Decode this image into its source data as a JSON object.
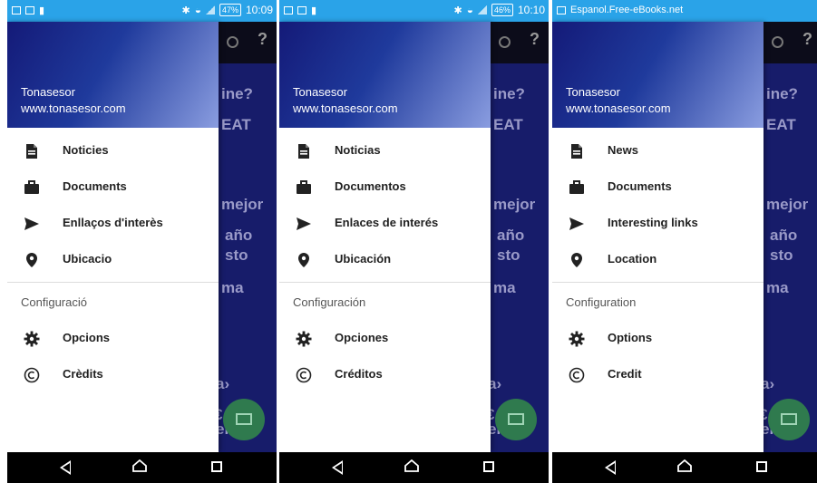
{
  "phones": [
    {
      "status": {
        "battery": "47%",
        "time": "10:09",
        "notification": ""
      },
      "drawer": {
        "name": "Tonasesor",
        "url": "www.tonasesor.com",
        "items": [
          "Noticies",
          "Documents",
          "Enllaços d'interès",
          "Ubicacio"
        ],
        "section_title": "Configuració",
        "config_items": [
          "Opcions",
          "Crèdits"
        ]
      },
      "background_texts": [
        "ine?",
        "EAT",
        "mejor",
        "año",
        "sto",
        "ma",
        "a›",
        "€",
        "en"
      ]
    },
    {
      "status": {
        "battery": "46%",
        "time": "10:10",
        "notification": ""
      },
      "drawer": {
        "name": "Tonasesor",
        "url": "www.tonasesor.com",
        "items": [
          "Noticias",
          "Documentos",
          "Enlaces de interés",
          "Ubicación"
        ],
        "section_title": "Configuración",
        "config_items": [
          "Opciones",
          "Créditos"
        ]
      },
      "background_texts": [
        "ine?",
        "EAT",
        "mejor",
        "año",
        "sto",
        "ma",
        "a›",
        "€",
        "en"
      ]
    },
    {
      "status": {
        "battery": "",
        "time": "",
        "notification": "Espanol.Free-eBooks.net"
      },
      "drawer": {
        "name": "Tonasesor",
        "url": "www.tonasesor.com",
        "items": [
          "News",
          "Documents",
          "Interesting links",
          "Location"
        ],
        "section_title": "Configuration",
        "config_items": [
          "Options",
          "Credit"
        ]
      },
      "background_texts": [
        "ine?",
        "EAT",
        "mejor",
        "año",
        "sto",
        "ma",
        "a›",
        "€",
        "en"
      ]
    }
  ],
  "icons": {
    "items": [
      "document-icon",
      "briefcase-icon",
      "send-icon",
      "location-pin-icon"
    ],
    "config_items": [
      "gear-icon",
      "copyright-icon"
    ]
  },
  "colors": {
    "status_bar": "#2aa3e8",
    "drawer_header": "#141a78",
    "app_background": "#171c6a",
    "fab": "#2f7a4e"
  }
}
